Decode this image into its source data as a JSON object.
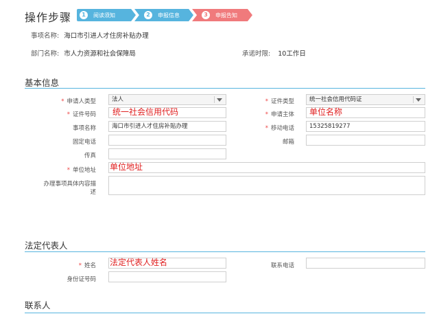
{
  "steps": {
    "title": "操作步骤",
    "items": [
      {
        "num": "1",
        "label": "阅读须知"
      },
      {
        "num": "2",
        "label": "申报信息"
      },
      {
        "num": "3",
        "label": "申报告知"
      }
    ]
  },
  "meta": {
    "item_name_label": "事项名称:",
    "item_name_value": "海口市引进人才住房补贴办理",
    "dept_label": "部门名称:",
    "dept_value": "市人力资源和社会保障局",
    "deadline_label": "承诺时限:",
    "deadline_value": "10工作日"
  },
  "basic": {
    "title": "基本信息",
    "applicant_type_label": "申请人类型",
    "applicant_type_value": "法人",
    "cert_type_label": "证件类型",
    "cert_type_value": "统一社会信用代码证",
    "cert_no_label": "证件号码",
    "cert_no_value": "统一社会信用代码",
    "applicant_label": "申请主体",
    "applicant_value": "单位名称",
    "item_label": "事项名称",
    "item_value": "海口市引进人才住房补贴办理",
    "mobile_label": "移动电话",
    "mobile_value": "15325819277",
    "phone_label": "固定电话",
    "email_label": "邮箱",
    "fax_label": "传真",
    "address_label": "单位地址",
    "address_value": "单位地址",
    "desc_label_1": "办理事项具体内容描",
    "desc_label_2": "述"
  },
  "legal": {
    "title": "法定代表人",
    "name_label": "姓名",
    "name_value": "法定代表人姓名",
    "contact_label": "联系电话",
    "id_label": "身份证号码"
  },
  "contact": {
    "title": "联系人"
  },
  "colors": {
    "step_done": "#56b4de",
    "step_current": "#f07a7c",
    "required": "#e44444",
    "handwriting": "#e02020"
  }
}
